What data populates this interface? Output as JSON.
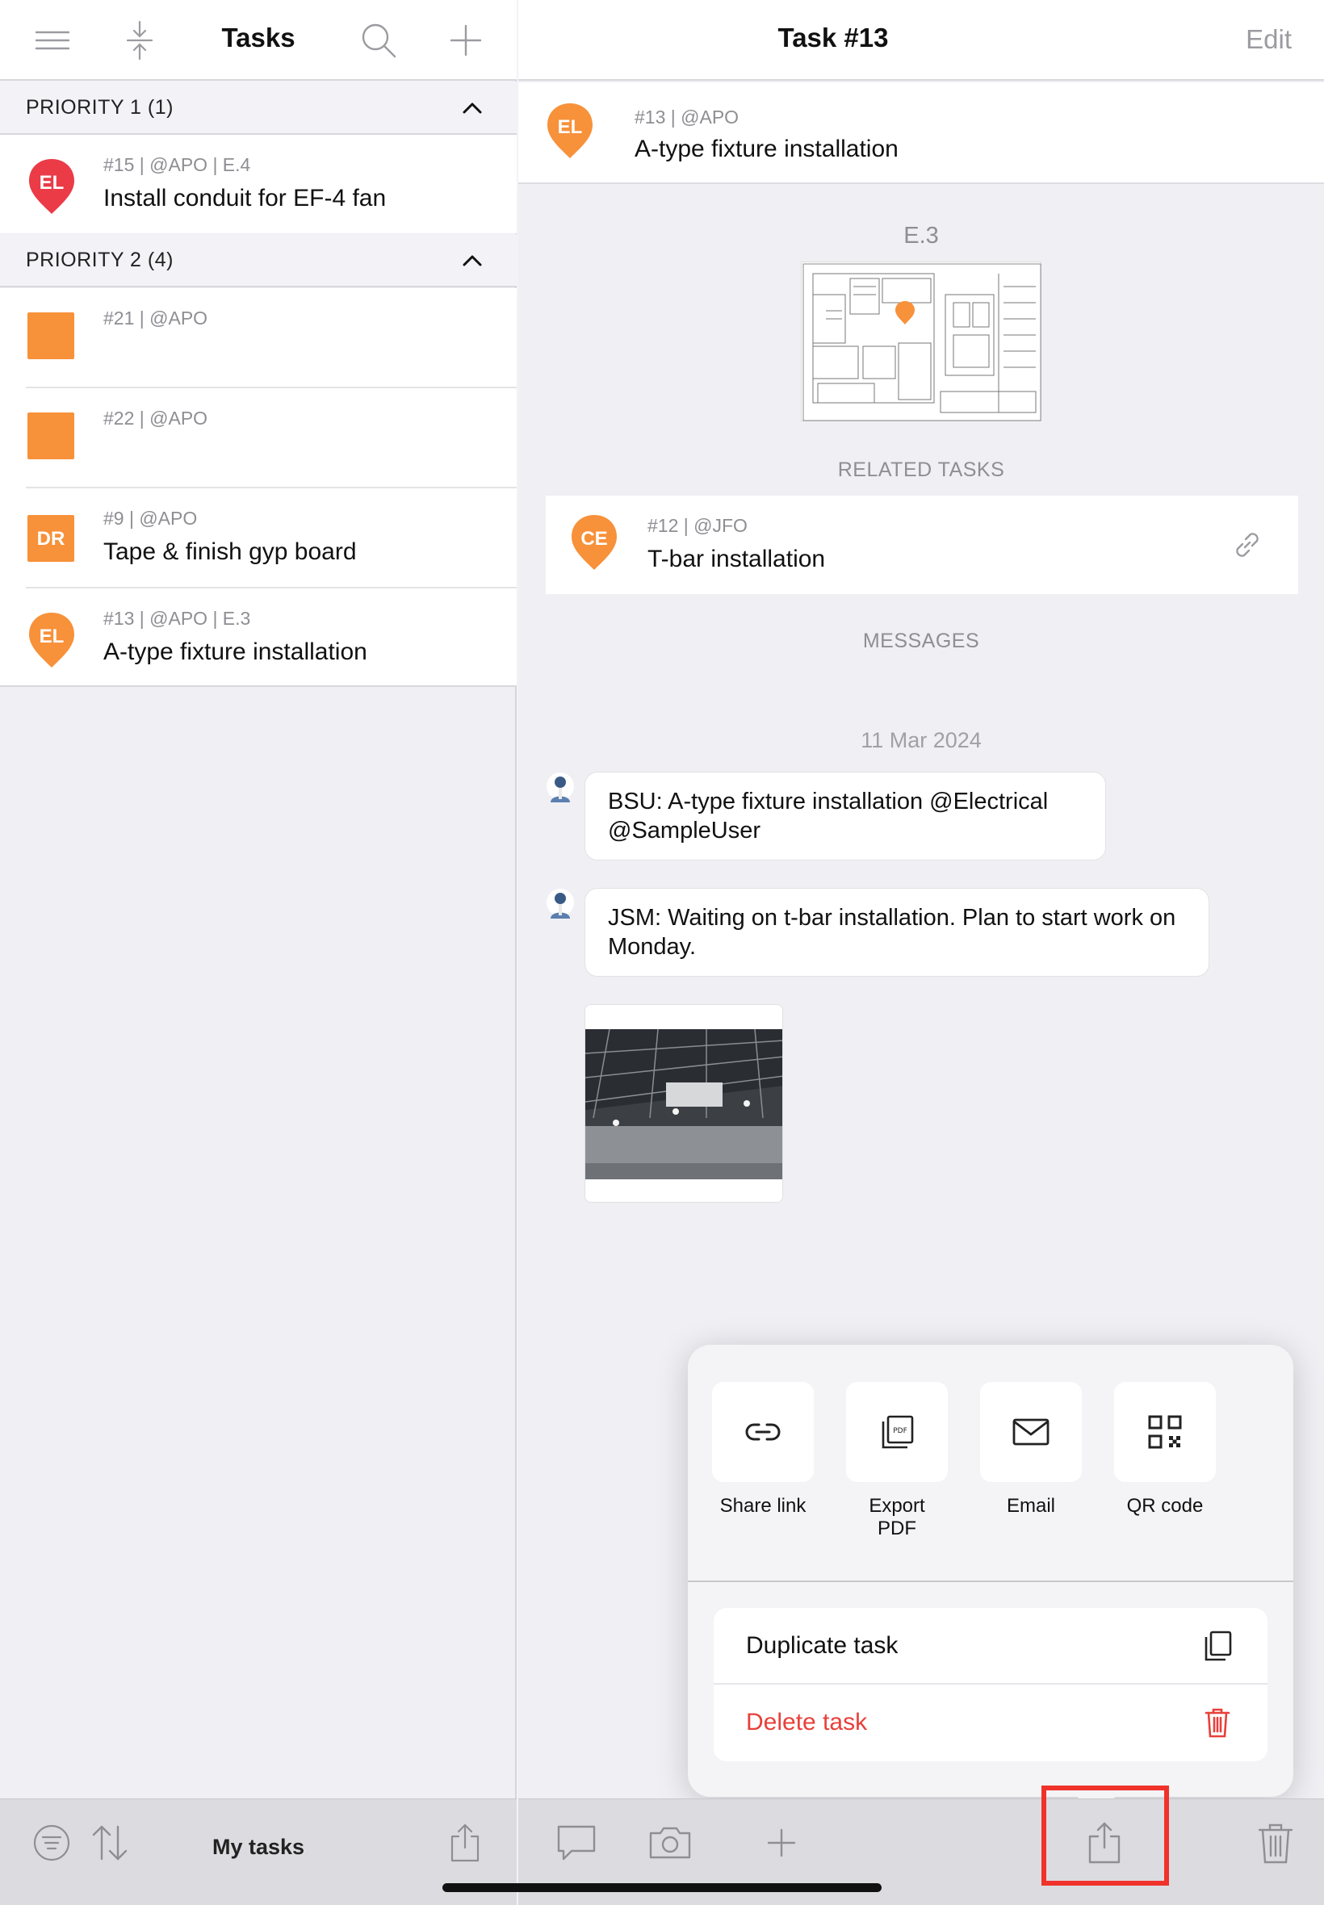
{
  "left": {
    "header": {
      "title": "Tasks",
      "icons": [
        "menu-icon",
        "collapse-icon",
        "search-icon",
        "plus-icon"
      ]
    },
    "sections": [
      {
        "label": "PRIORITY 1 (1)",
        "tasks": [
          {
            "meta": "#15 | @APO | E.4",
            "name": "Install conduit for EF-4 fan",
            "badge": "EL",
            "shape": "pin",
            "color": "#ea3b47"
          }
        ]
      },
      {
        "label": "PRIORITY 2 (4)",
        "tasks": [
          {
            "meta": "#21 | @APO",
            "name": "",
            "badge": "",
            "shape": "square",
            "color": "#f7913a"
          },
          {
            "meta": "#22 | @APO",
            "name": "",
            "badge": "",
            "shape": "square",
            "color": "#f7913a"
          },
          {
            "meta": "#9 | @APO",
            "name": "Tape & finish gyp board",
            "badge": "DR",
            "shape": "square",
            "color": "#f7913a"
          },
          {
            "meta": "#13 | @APO | E.3",
            "name": "A-type fixture installation",
            "badge": "EL",
            "shape": "pin",
            "color": "#f7913a"
          }
        ]
      }
    ],
    "bottom": {
      "label": "My tasks",
      "icons": [
        "filter-icon",
        "sort-icon",
        "share-icon"
      ]
    }
  },
  "right": {
    "header": {
      "title": "Task #13",
      "edit": "Edit"
    },
    "task": {
      "meta": "#13 | @APO",
      "name": "A-type fixture installation",
      "badge": "EL",
      "color": "#f7913a"
    },
    "plan_label": "E.3",
    "related_header": "RELATED TASKS",
    "related": {
      "meta": "#12 | @JFO",
      "name": "T-bar installation",
      "badge": "CE",
      "color": "#f7913a"
    },
    "messages_header": "MESSAGES",
    "date": "11 Mar 2024",
    "messages": [
      {
        "text": "BSU: A-type fixture installation @Electrical @SampleUser"
      },
      {
        "text": "JSM: Waiting on t-bar installation. Plan to start work on Monday."
      }
    ],
    "popover": {
      "actions": [
        {
          "label": "Share link",
          "icon": "link-icon"
        },
        {
          "label": "Export PDF",
          "icon": "pdf-icon"
        },
        {
          "label": "Email",
          "icon": "email-icon"
        },
        {
          "label": "QR code",
          "icon": "qr-code-icon"
        }
      ],
      "duplicate": "Duplicate task",
      "delete": "Delete task",
      "delete_color": "#e8403a"
    },
    "bottom_icons": [
      "comment-icon",
      "camera-icon",
      "plus-icon",
      "share-icon",
      "trash-icon"
    ]
  }
}
